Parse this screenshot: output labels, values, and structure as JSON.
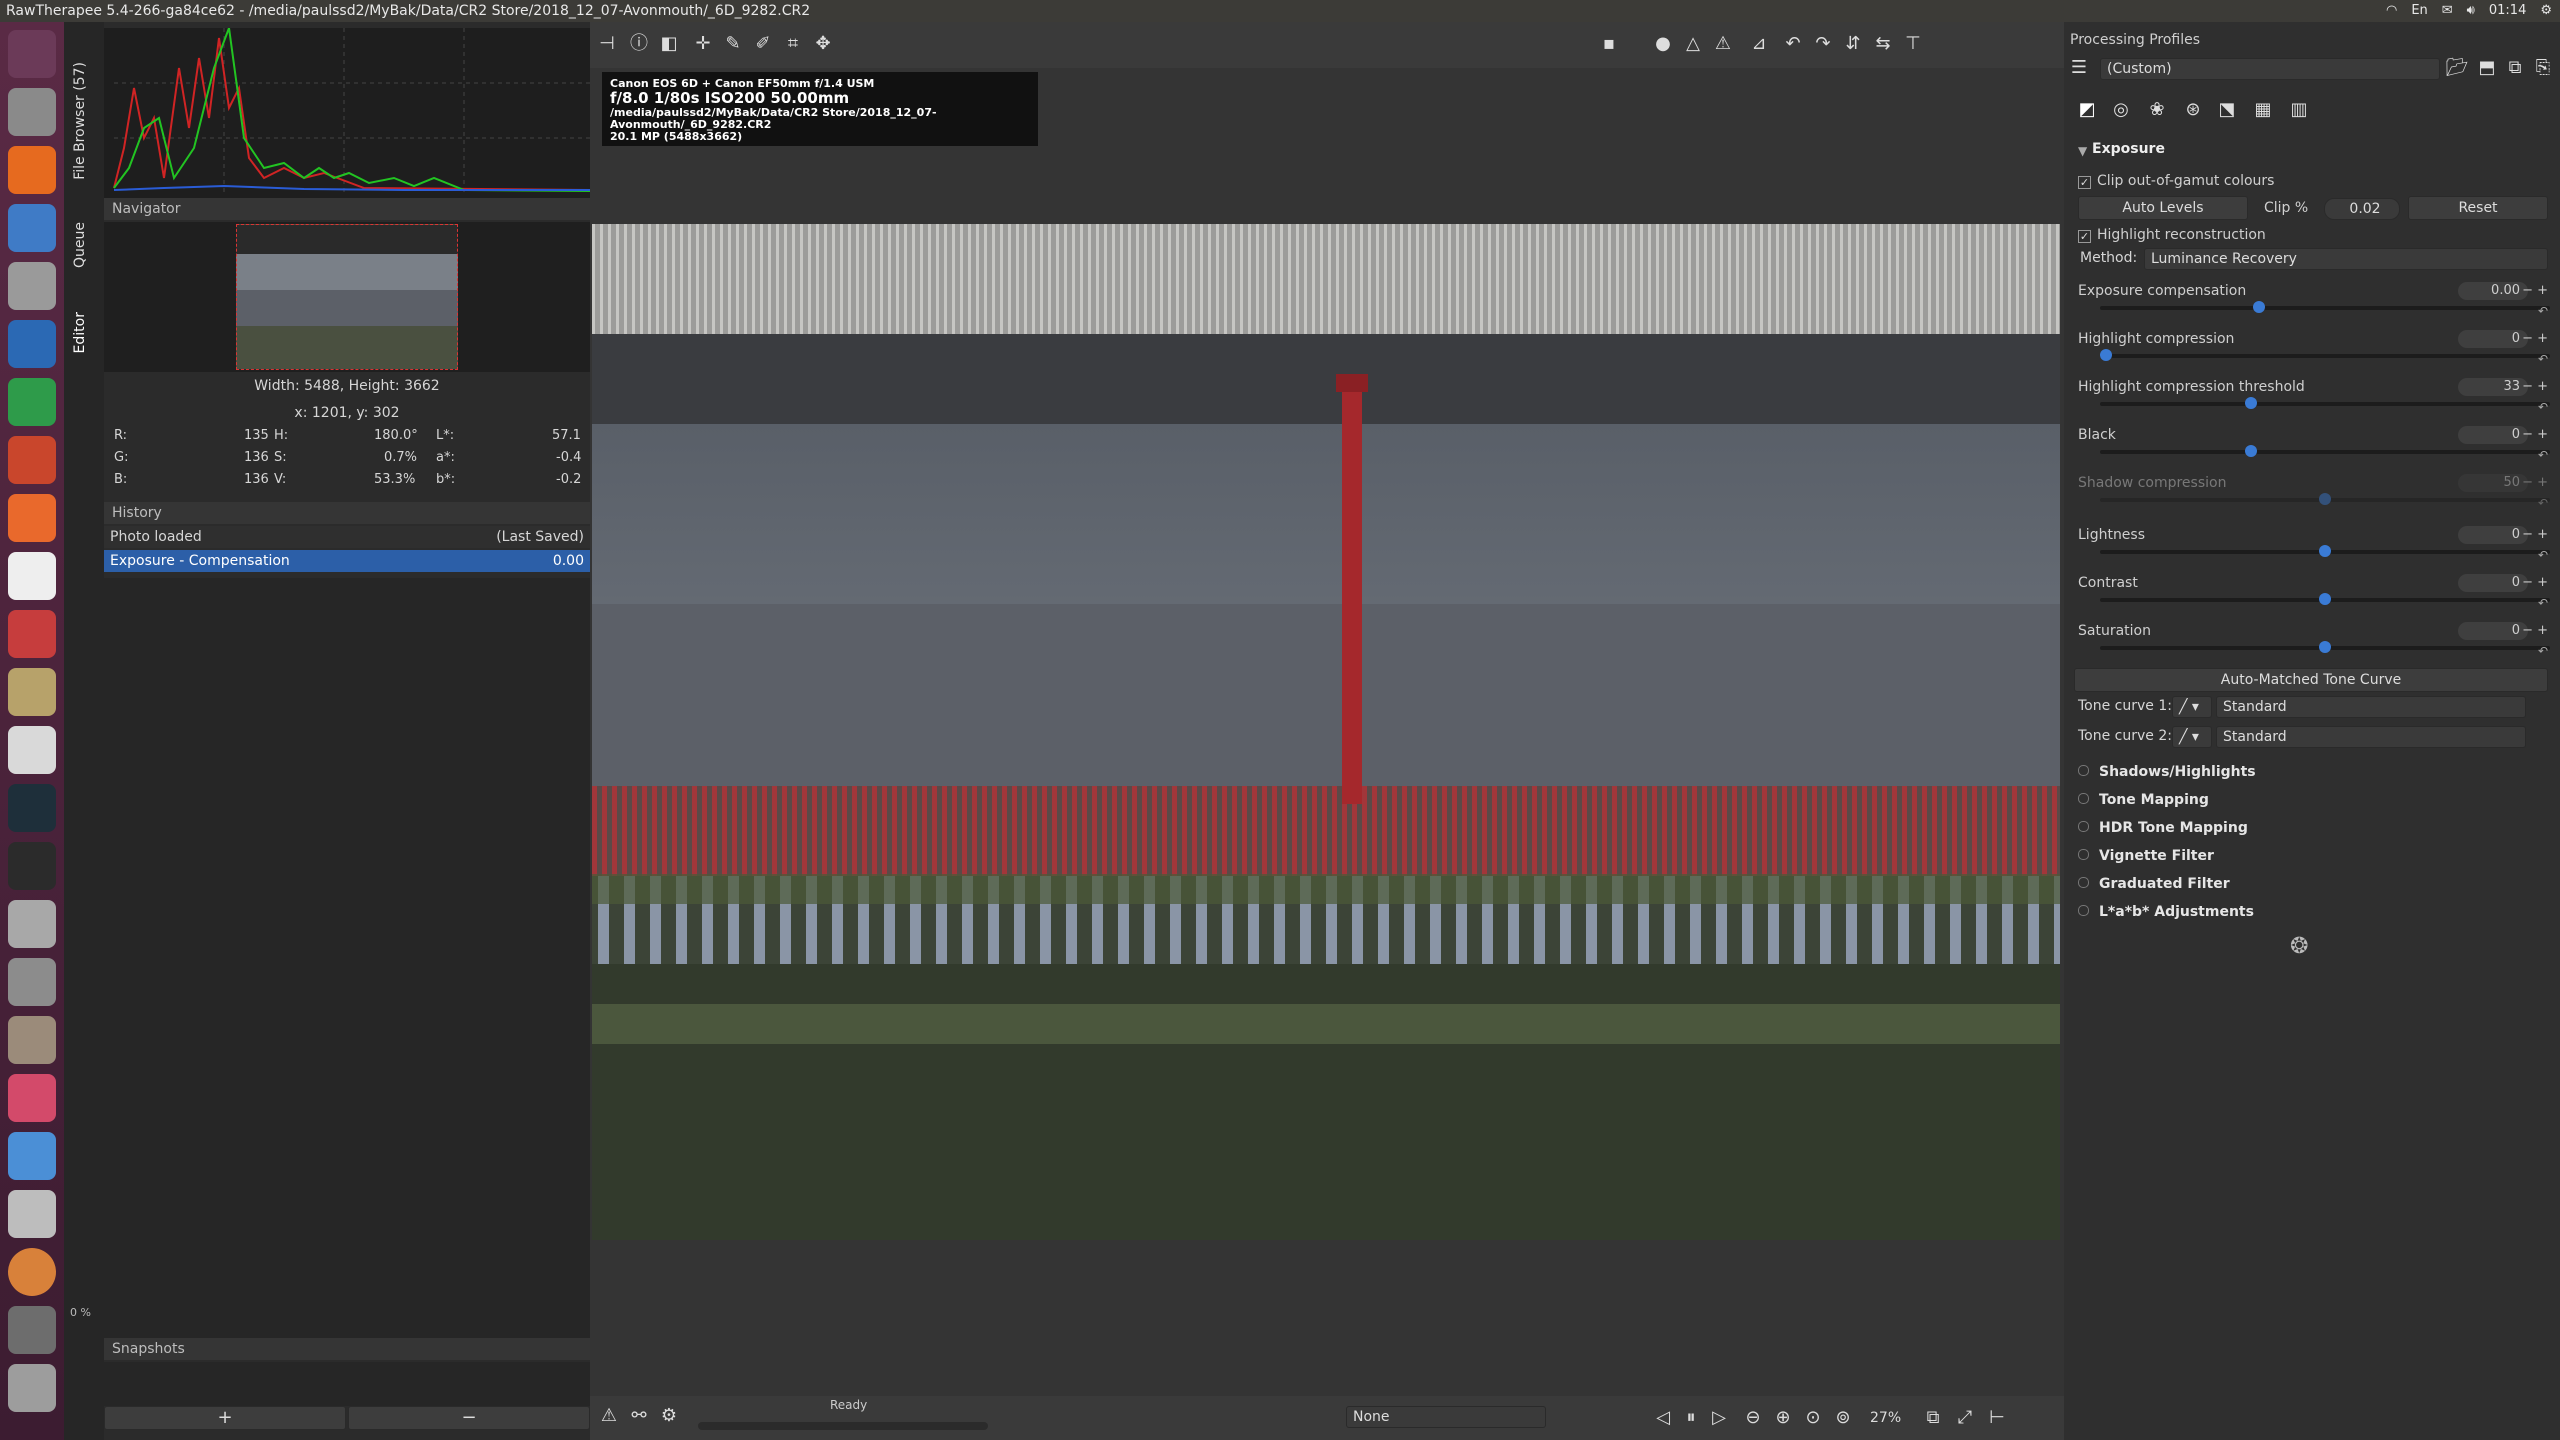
{
  "window_title": "RawTherapee 5.4-266-ga84ce62 - /media/paulssd2/MyBak/Data/CR2 Store/2018_12_07-Avonmouth/_6D_9282.CR2",
  "tray": {
    "lang": "En",
    "time": "01:14"
  },
  "vtabs": {
    "file_browser": "File Browser (57)",
    "queue": "Queue",
    "editor": "Editor",
    "zoom_pct": "0 %"
  },
  "navigator": {
    "title": "Navigator",
    "dims": "Width: 5488, Height: 3662",
    "coords": "x: 1201, y: 302"
  },
  "readout": {
    "r": "135",
    "g": "136",
    "b": "136",
    "h": "180.0°",
    "s": "0.7%",
    "v": "53.3%",
    "l": "57.1",
    "a": "-0.4",
    "bb": "-0.2"
  },
  "history": {
    "title": "History",
    "rows": [
      {
        "label": "Photo loaded",
        "value": "(Last Saved)"
      },
      {
        "label": "Exposure - Compensation",
        "value": "0.00"
      }
    ]
  },
  "snapshots": {
    "title": "Snapshots",
    "add": "+",
    "remove": "−"
  },
  "exif": {
    "camera": "Canon EOS 6D + Canon EF50mm f/1.4 USM",
    "shot": "f/8.0  1/80s  ISO200  50.00mm",
    "path": "/media/paulssd2/MyBak/Data/CR2 Store/2018_12_07-Avonmouth/_6D_9282.CR2",
    "size": "20.1 MP (5488x3662)"
  },
  "status": {
    "ready": "Ready",
    "preview_mode": "None",
    "zoom": "27%"
  },
  "right": {
    "title": "Processing Profiles",
    "profile": "(Custom)",
    "exposure": "Exposure",
    "clip_oog": "Clip out-of-gamut colours",
    "auto_levels": "Auto Levels",
    "clip_label": "Clip %",
    "clip_value": "0.02",
    "reset": "Reset",
    "highlight_recon": "Highlight reconstruction",
    "method_label": "Method:",
    "method_value": "Luminance Recovery",
    "sliders": [
      {
        "label": "Exposure compensation",
        "value": "0.00",
        "pos": 0.35
      },
      {
        "label": "Highlight compression",
        "value": "0",
        "pos": 0.0
      },
      {
        "label": "Highlight compression threshold",
        "value": "33",
        "pos": 0.33
      },
      {
        "label": "Black",
        "value": "0",
        "pos": 0.33
      },
      {
        "label": "Shadow compression",
        "value": "50",
        "pos": 0.5
      },
      {
        "label": "Lightness",
        "value": "0",
        "pos": 0.5
      },
      {
        "label": "Contrast",
        "value": "0",
        "pos": 0.5
      },
      {
        "label": "Saturation",
        "value": "0",
        "pos": 0.5
      }
    ],
    "auto_matched": "Auto-Matched Tone Curve",
    "tc1_label": "Tone curve 1:",
    "tc1_value": "Standard",
    "tc2_label": "Tone curve 2:",
    "tc2_value": "Standard",
    "folds": [
      "Shadows/Highlights",
      "Tone Mapping",
      "HDR Tone Mapping",
      "Vignette Filter",
      "Graduated Filter",
      "L*a*b* Adjustments"
    ]
  },
  "colors": {
    "accent": "#3a7bd5",
    "selection": "#2c5fa8",
    "launcher": "#4a2239"
  }
}
